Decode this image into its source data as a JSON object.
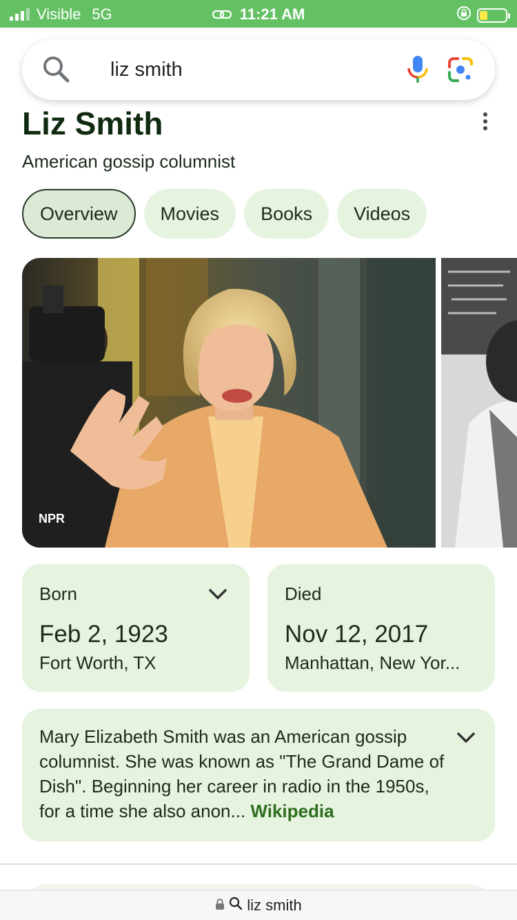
{
  "status_bar": {
    "carrier": "Visible",
    "network": "5G",
    "time": "11:21 AM",
    "battery_color": "#ffe94a",
    "background": "#63c164"
  },
  "search": {
    "query": "liz smith"
  },
  "knowledge_panel": {
    "title": "Liz Smith",
    "subtitle": "American gossip columnist",
    "chips": [
      "Overview",
      "Movies",
      "Books",
      "Videos"
    ],
    "active_chip": "Overview",
    "image_source": "NPR",
    "born": {
      "label": "Born",
      "date": "Feb 2, 1923",
      "place": "Fort Worth, TX"
    },
    "died": {
      "label": "Died",
      "date": "Nov 12, 2017",
      "place": "Manhattan, New Yor..."
    },
    "description": {
      "text": "Mary Elizabeth Smith was an American gossip columnist. She was known as \"The Grand Dame of Dish\". Beginning her career in radio in the 1950s, for a time she also anon...",
      "source": "Wikipedia"
    }
  },
  "url_bar": {
    "text": "liz smith"
  },
  "colors": {
    "accent_green": "#63c164",
    "card_bg": "#e6f3df",
    "link_green": "#2f6d1f"
  }
}
